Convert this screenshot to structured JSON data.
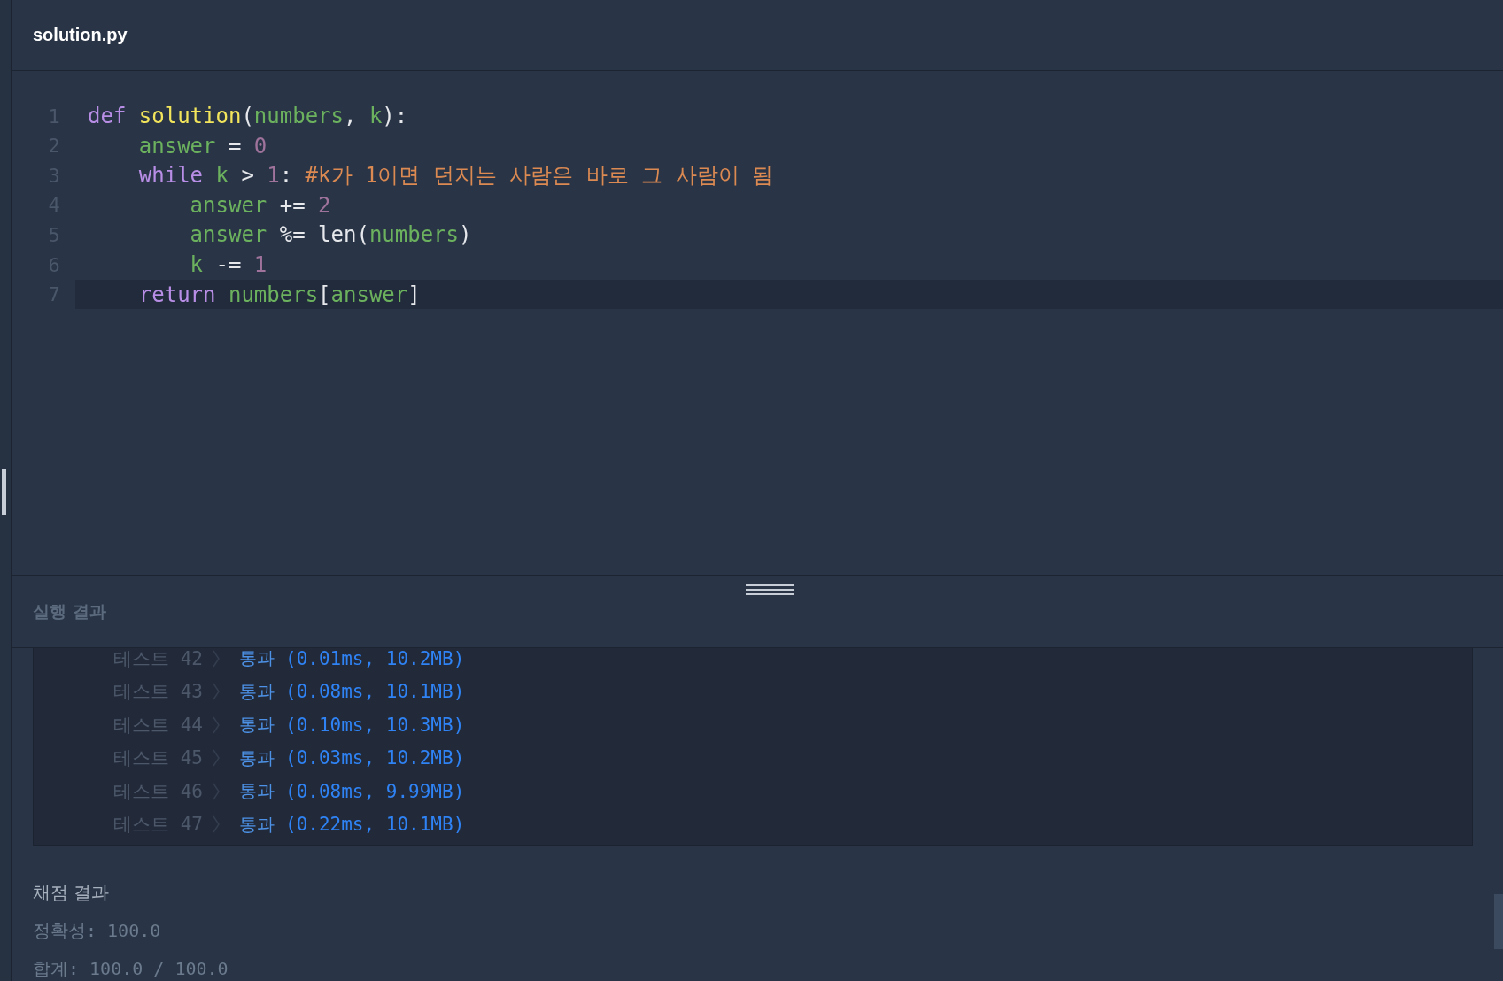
{
  "editor": {
    "filename": "solution.py",
    "lines": [
      {
        "number": "1",
        "active": false,
        "tokens": [
          {
            "kind": "keyword",
            "text": "def"
          },
          {
            "kind": "function",
            "text": "solution",
            "space_before": true
          },
          {
            "kind": "plain",
            "text": "("
          },
          {
            "kind": "variable",
            "text": "numbers"
          },
          {
            "kind": "plain",
            "text": ","
          },
          {
            "kind": "variable",
            "text": "k",
            "space_before": true
          },
          {
            "kind": "plain",
            "text": "):"
          }
        ],
        "children": [
          {
            "number": "2",
            "active": false,
            "tokens": [
              {
                "kind": "variable",
                "text": "answer"
              },
              {
                "kind": "plain",
                "text": "=",
                "space_before": true
              },
              {
                "kind": "number",
                "text": "0",
                "space_before": true
              }
            ]
          },
          {
            "number": "3",
            "active": false,
            "tokens": [
              {
                "kind": "keyword",
                "text": "while"
              },
              {
                "kind": "variable",
                "text": "k",
                "space_before": true
              },
              {
                "kind": "plain",
                "text": ">",
                "space_before": true
              },
              {
                "kind": "number",
                "text": "1",
                "space_before": true
              },
              {
                "kind": "plain",
                "text": ":"
              },
              {
                "kind": "comment",
                "text": "#k가 1이면 던지는 사람은 바로 그 사람이 됨",
                "space_before": true
              }
            ],
            "children": [
              {
                "number": "4",
                "active": false,
                "tokens": [
                  {
                    "kind": "variable",
                    "text": "answer"
                  },
                  {
                    "kind": "plain",
                    "text": "+=",
                    "space_before": true
                  },
                  {
                    "kind": "number",
                    "text": "2",
                    "space_before": true
                  }
                ]
              },
              {
                "number": "5",
                "active": false,
                "tokens": [
                  {
                    "kind": "variable",
                    "text": "answer"
                  },
                  {
                    "kind": "plain",
                    "text": "%= len(",
                    "space_before": true
                  },
                  {
                    "kind": "variable",
                    "text": "numbers"
                  },
                  {
                    "kind": "plain",
                    "text": ")"
                  }
                ]
              },
              {
                "number": "6",
                "active": false,
                "tokens": [
                  {
                    "kind": "variable",
                    "text": "k"
                  },
                  {
                    "kind": "plain",
                    "text": "-=",
                    "space_before": true
                  },
                  {
                    "kind": "number",
                    "text": "1",
                    "space_before": true
                  }
                ]
              }
            ]
          },
          {
            "number": "7",
            "active": true,
            "tokens": [
              {
                "kind": "keyword",
                "text": "return"
              },
              {
                "kind": "variable",
                "text": "numbers",
                "space_before": true
              },
              {
                "kind": "plain",
                "text": "["
              },
              {
                "kind": "variable",
                "text": "answer"
              },
              {
                "kind": "plain",
                "text": "]"
              }
            ]
          }
        ]
      }
    ]
  },
  "results": {
    "title": "실행 결과",
    "tests": [
      {
        "label": "테스트 42",
        "status": "통과",
        "detail": "(0.01ms, 10.2MB)"
      },
      {
        "label": "테스트 43",
        "status": "통과",
        "detail": "(0.08ms, 10.1MB)"
      },
      {
        "label": "테스트 44",
        "status": "통과",
        "detail": "(0.10ms, 10.3MB)"
      },
      {
        "label": "테스트 45",
        "status": "통과",
        "detail": "(0.03ms, 10.2MB)"
      },
      {
        "label": "테스트 46",
        "status": "통과",
        "detail": "(0.08ms, 9.99MB)"
      },
      {
        "label": "테스트 47",
        "status": "통과",
        "detail": "(0.22ms, 10.1MB)"
      }
    ],
    "grading": {
      "title": "채점 결과",
      "lines": [
        "정확성: 100.0",
        "합계: 100.0 / 100.0"
      ]
    }
  }
}
